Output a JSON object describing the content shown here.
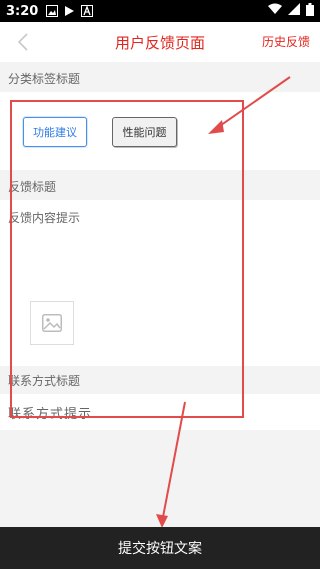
{
  "status_bar": {
    "time": "3:20"
  },
  "header": {
    "title": "用户反馈页面",
    "history_link": "历史反馈"
  },
  "category": {
    "title": "分类标签标题",
    "tags": [
      "功能建议",
      "性能问题"
    ]
  },
  "feedback": {
    "title": "反馈标题",
    "content_hint": "反馈内容提示"
  },
  "contact": {
    "title": "联系方式标题",
    "hint": "联系方式提示"
  },
  "submit": {
    "label": "提交按钮文案"
  },
  "colors": {
    "accent": "#e2261f",
    "annotation": "#e24b4b",
    "selected_tag": "#2c7be5",
    "submit_bg": "#222222",
    "section_bg": "#f3f3f3"
  },
  "icons": {
    "status_bar": [
      "gallery-icon",
      "play-store-icon",
      "a-icon",
      "wifi-icon",
      "signal-icon",
      "battery-icon"
    ],
    "back": "chevron-left-icon",
    "image_placeholder": "image-placeholder-icon"
  }
}
